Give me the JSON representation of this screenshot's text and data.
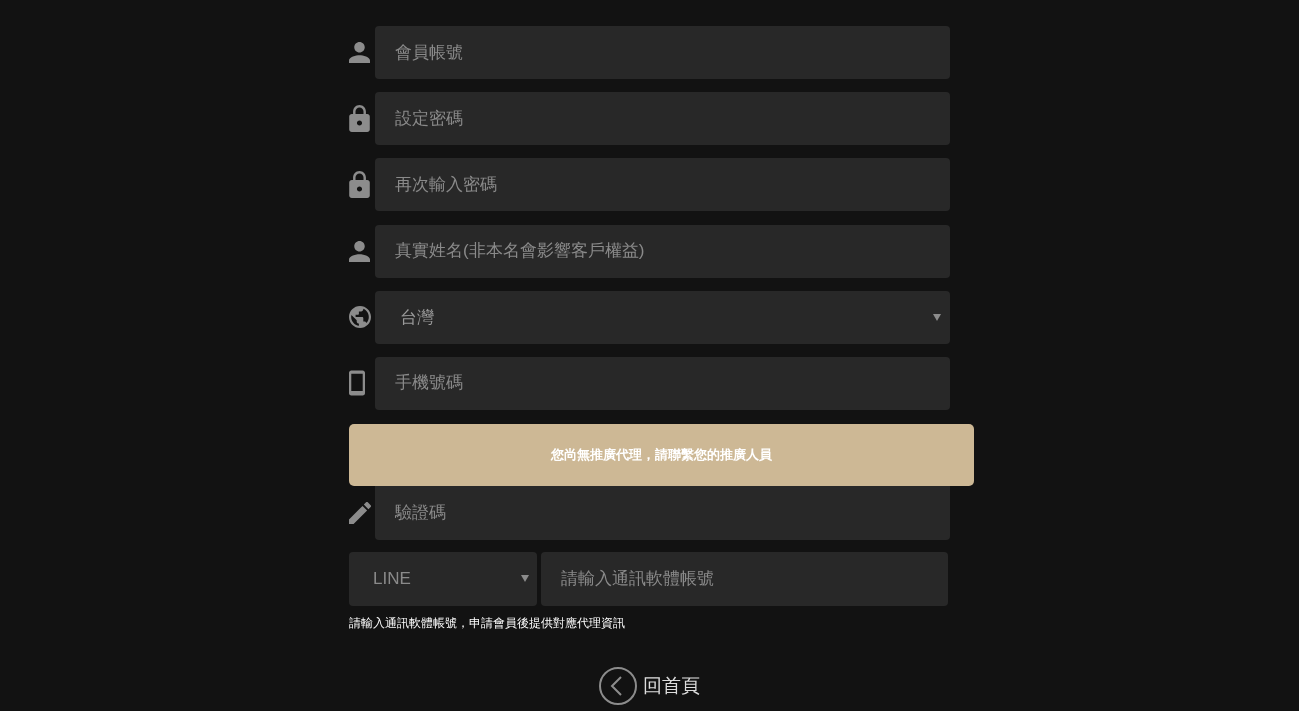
{
  "fields": [
    {
      "kind": "text",
      "placeholder": "會員帳號"
    },
    {
      "kind": "password",
      "placeholder": "設定密碼"
    },
    {
      "kind": "password",
      "placeholder": "再次輸入密碼"
    },
    {
      "kind": "text",
      "placeholder": "真實姓名(非本名會影響客戶權益)"
    },
    {
      "kind": "select",
      "value": "台灣"
    },
    {
      "kind": "tel",
      "placeholder": "手機號碼"
    }
  ],
  "notice": {
    "text": "您尚無推廣代理，請聯繫您的推廣人員"
  },
  "captcha": {
    "placeholder": "驗證碼"
  },
  "messenger": {
    "app": {
      "value": "LINE"
    },
    "account": {
      "placeholder": "請輸入通訊軟體帳號"
    }
  },
  "hint": "請輸入通訊軟體帳號，申請會員後提供對應代理資訊",
  "back_link": {
    "label": "回首頁"
  }
}
